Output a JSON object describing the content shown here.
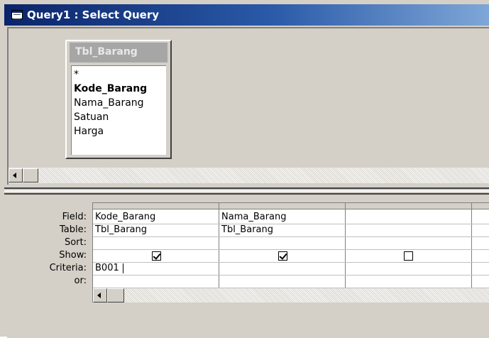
{
  "window": {
    "title": "Query1 : Select Query",
    "icon": "query-icon",
    "colors": {
      "titlebar_start": "#0a246a",
      "titlebar_end": "#7fa7d8",
      "face": "#d4d0c8"
    }
  },
  "table_list": {
    "title": "Tbl_Barang",
    "fields": [
      {
        "name": "*",
        "bold": false
      },
      {
        "name": "Kode_Barang",
        "bold": true
      },
      {
        "name": "Nama_Barang",
        "bold": false
      },
      {
        "name": "Satuan",
        "bold": false
      },
      {
        "name": "Harga",
        "bold": false
      }
    ]
  },
  "grid": {
    "row_labels": {
      "field": "Field:",
      "table": "Table:",
      "sort": "Sort:",
      "show": "Show:",
      "criteria": "Criteria:",
      "or": "or:"
    },
    "columns": [
      {
        "field": "Kode_Barang",
        "table": "Tbl_Barang",
        "sort": "",
        "show": true,
        "criteria": "B001",
        "or": ""
      },
      {
        "field": "Nama_Barang",
        "table": "Tbl_Barang",
        "sort": "",
        "show": true,
        "criteria": "",
        "or": ""
      },
      {
        "field": "",
        "table": "",
        "sort": "",
        "show": false,
        "criteria": "",
        "or": ""
      },
      {
        "field": "",
        "table": "",
        "sort": "",
        "show": false,
        "criteria": "",
        "or": ""
      }
    ],
    "active_cell": "criteria-col-1"
  }
}
